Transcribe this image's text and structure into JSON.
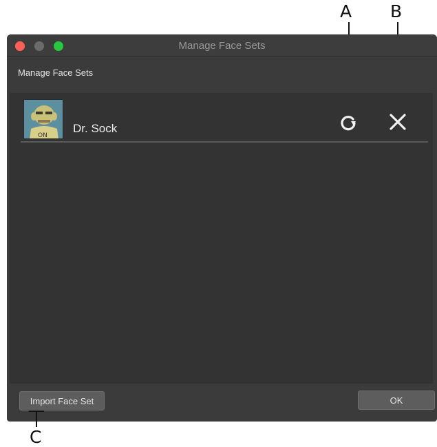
{
  "callouts": {
    "a": "A",
    "b": "B",
    "c": "C"
  },
  "window": {
    "title": "Manage Face Sets",
    "section_label": "Manage Face Sets"
  },
  "face_sets": [
    {
      "name": "Dr. Sock",
      "avatar_icon": "face-avatar-icon",
      "reload_icon": "reload-icon",
      "remove_icon": "close-icon"
    }
  ],
  "footer": {
    "import_label": "Import Face Set",
    "ok_label": "OK"
  },
  "colors": {
    "window_bg": "#3b3b3b",
    "panel_bg": "#333333",
    "close_dot": "#fe5f57",
    "min_dot": "#6b6b6b",
    "max_dot": "#28c940"
  }
}
